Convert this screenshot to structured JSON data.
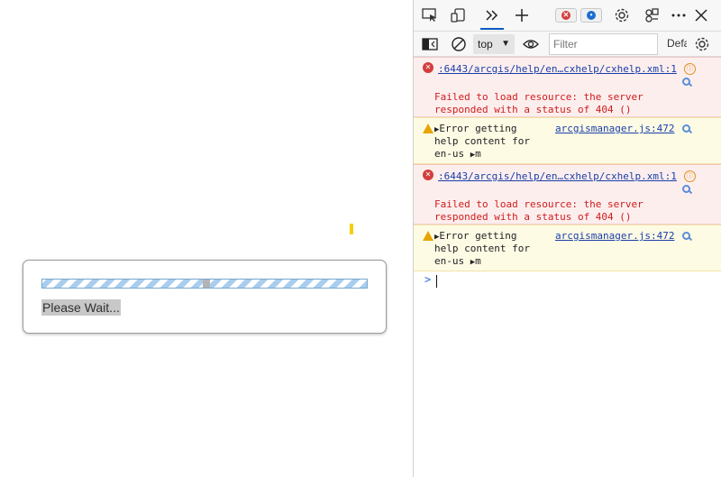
{
  "page": {
    "dialog": {
      "wait_text": "Please Wait..."
    }
  },
  "devtools": {
    "tabs": {
      "inspect_icon": "inspect-element-icon",
      "device_icon": "device-emulation-icon",
      "more_tabs_icon": "chevrons-right-icon",
      "add_tab_icon": "plus-icon",
      "settings_icon": "gear-icon",
      "customize_icon": "customize-icon",
      "more_icon": "ellipsis-icon",
      "close_icon": "close-icon"
    },
    "badges": {
      "error_color": "#d33d3d",
      "info_color": "#1a6fd0"
    },
    "toolbar": {
      "context": "top",
      "filter_placeholder": "Filter",
      "levels": "Default levels"
    },
    "messages": [
      {
        "level": "error",
        "source": ":6443/arcgis/help/en…cxhelp/cxhelp.xml:1",
        "text_lines": [
          "Failed to load resource: the server",
          "responded with a status of 404 ()"
        ]
      },
      {
        "level": "warning",
        "text_lines": [
          "Error getting",
          "help content for",
          "en-us"
        ],
        "object": "m",
        "source": "arcgismanager.js:472"
      },
      {
        "level": "error",
        "source": ":6443/arcgis/help/en…cxhelp/cxhelp.xml:1",
        "text_lines": [
          "Failed to load resource: the server",
          "responded with a status of 404 ()"
        ]
      },
      {
        "level": "warning",
        "text_lines": [
          "Error getting",
          "help content for",
          "en-us"
        ],
        "object": "m",
        "source": "arcgismanager.js:472"
      }
    ],
    "prompt": ">"
  }
}
